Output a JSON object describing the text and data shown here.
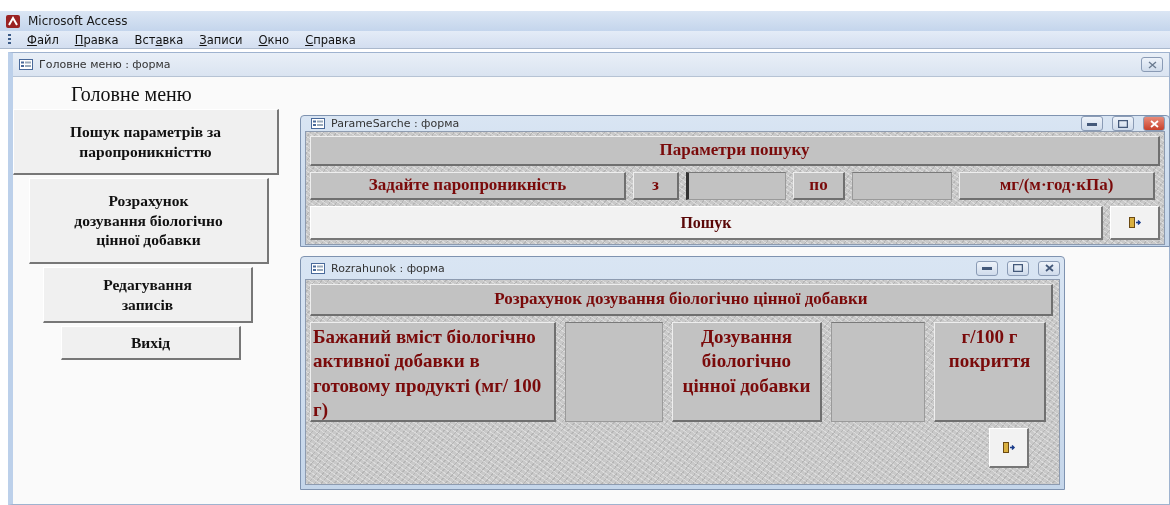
{
  "app": {
    "title": "Microsoft Access"
  },
  "menu": [
    {
      "key": "Ф",
      "after": "айл"
    },
    {
      "key": "П",
      "after": "равка"
    },
    {
      "before": "Вст",
      "key": "а",
      "after": "вка"
    },
    {
      "key": "З",
      "after": "аписи"
    },
    {
      "key": "О",
      "after": "кно"
    },
    {
      "key": "С",
      "after": "правка"
    }
  ],
  "main_form": {
    "title": "Головне меню : форма",
    "heading": "Головне меню",
    "buttons": [
      "Пошук параметрів за\nпаропроникністтю",
      "Розрахунок\nдозування біологічно\nцінної добавки",
      "Редагування\nзаписів",
      "Вихід"
    ]
  },
  "search_form": {
    "title": "ParameSarche : форма",
    "active": true,
    "heading": "Параметри пошуку",
    "row": [
      {
        "kind": "label",
        "text": "Задайте паропроникність"
      },
      {
        "kind": "label",
        "text": "з"
      },
      {
        "kind": "input",
        "focused": true
      },
      {
        "kind": "label",
        "text": "по"
      },
      {
        "kind": "input",
        "focused": false
      },
      {
        "kind": "label",
        "text": "мг/(м·год·кПа)"
      }
    ],
    "search_button": "Пошук"
  },
  "calc_form": {
    "title": "Rozrahunok : форма",
    "active": false,
    "heading": "Розрахунок дозування біологічно цінної добавки",
    "row": [
      {
        "kind": "label",
        "text": "Бажаний вміст біологічно активної добавки в готовому продукті (мг/ 100 г)"
      },
      {
        "kind": "input",
        "focused": false
      },
      {
        "kind": "label",
        "text": "Дозування біологічно цінної добавки"
      },
      {
        "kind": "input",
        "focused": false
      },
      {
        "kind": "label",
        "text": "г/100 г покриття"
      }
    ]
  }
}
